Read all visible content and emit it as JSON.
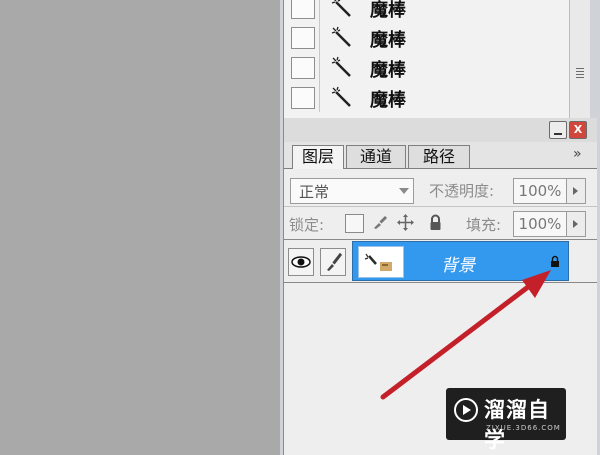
{
  "history": {
    "items": [
      {
        "label": "魔棒"
      },
      {
        "label": "魔棒"
      },
      {
        "label": "魔棒"
      },
      {
        "label": "魔棒"
      }
    ]
  },
  "layers_panel": {
    "tabs": [
      {
        "label": "图层",
        "active": true
      },
      {
        "label": "通道",
        "active": false
      },
      {
        "label": "路径",
        "active": false
      }
    ],
    "menu_glyph": "»",
    "close_glyph": "X",
    "blend_mode": "正常",
    "opacity_label": "不透明度:",
    "opacity_value": "100%",
    "lock_label": "锁定:",
    "fill_label": "填充:",
    "fill_value": "100%",
    "layer": {
      "name": "背景",
      "selected": true,
      "locked": true
    }
  },
  "annotation": {
    "arrow_color": "#c4202a"
  },
  "watermark": {
    "name": "溜溜自学",
    "url": "ZIXUE.3D66.COM"
  },
  "colors": {
    "selection": "#3399ef",
    "canvas": "#a9a9a9",
    "close_button": "#d2473b"
  }
}
